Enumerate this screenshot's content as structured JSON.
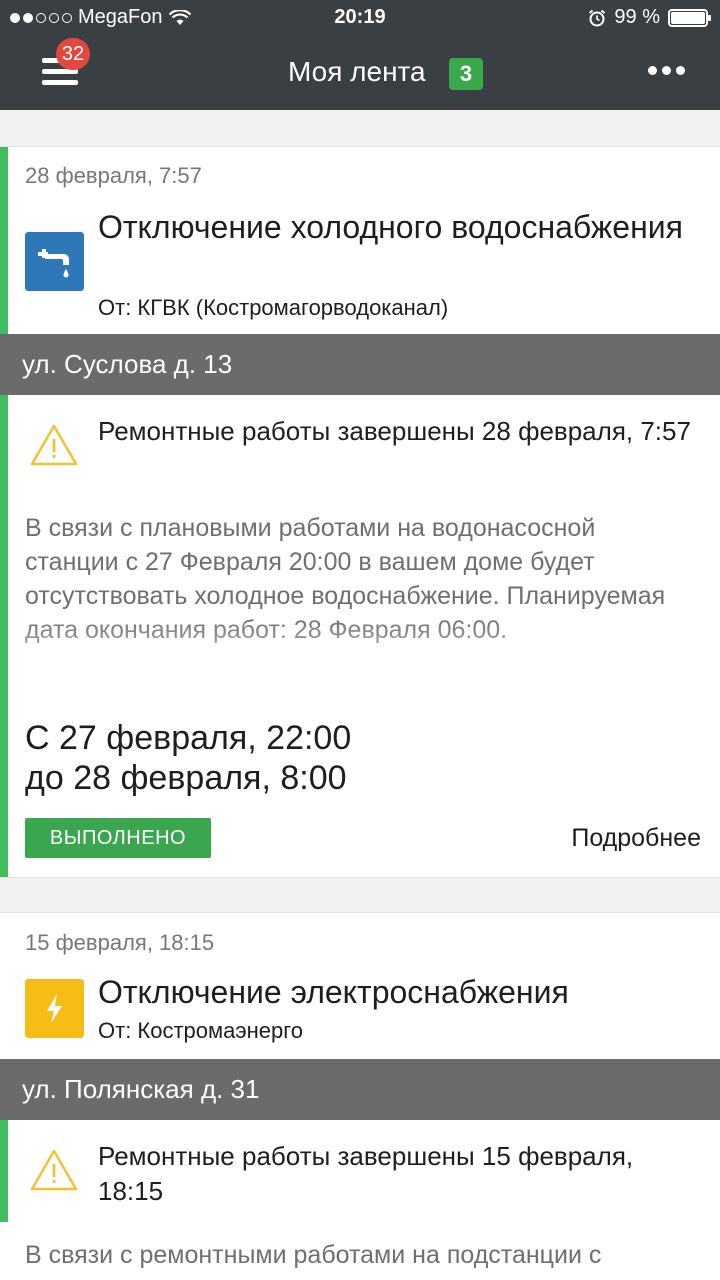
{
  "status_bar": {
    "carrier": "MegaFon",
    "time": "20:19",
    "battery": "99 %",
    "battery_level": 0.99
  },
  "header": {
    "menu_badge": "32",
    "title": "Моя лента",
    "count_badge": "3"
  },
  "colors": {
    "header_bg": "#3a3f44",
    "accent_green": "#3fbd5f",
    "badge_red": "#e2483d",
    "water_icon": "#2f78b8",
    "power_icon": "#f5bd15",
    "address_bg": "#6b6b6b"
  },
  "feed": [
    {
      "date": "28 февраля, 7:57",
      "icon": "water-tap-icon",
      "title": "Отключение холодного водоснабжения",
      "from": "От: КГВК (Костромагорводоканал)",
      "address": "ул. Суслова д. 13",
      "status_text": "Ремонтные работы завершены 28 февраля, 7:57",
      "description": "В связи с плановыми работами на водонасосной станции с 27 Февраля 20:00 в вашем доме будет отсутствовать холодное водоснабжение. Планируемая дата окончания работ: 28 Февраля 06:00.",
      "period_from": "С 27 февраля, 22:00",
      "period_to": "до 28 февраля, 8:00",
      "badge": "ВЫПОЛНЕНО",
      "more": "Подробнее"
    },
    {
      "date": "15 февраля, 18:15",
      "icon": "lightning-icon",
      "title": "Отключение электроснабжения",
      "from": "От: Костромаэнерго",
      "address": "ул. Полянская д. 31",
      "status_text": "Ремонтные работы завершены 15 февраля, 18:15",
      "description": "В связи с ремонтными работами на подстанции с"
    }
  ]
}
